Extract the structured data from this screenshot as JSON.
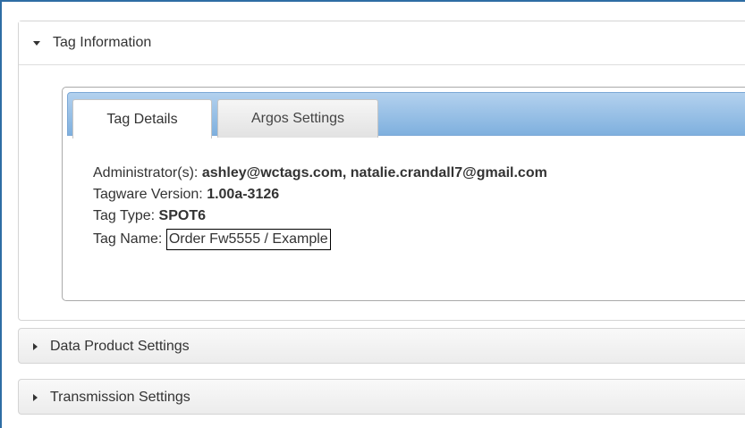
{
  "accordion": {
    "tag_information": {
      "title": "Tag Information",
      "tabs": [
        {
          "label": "Tag Details",
          "active": true
        },
        {
          "label": "Argos Settings",
          "active": false
        }
      ],
      "details": {
        "administrators_label": "Administrator(s):",
        "administrators_value": "ashley@wctags.com, natalie.crandall7@gmail.com",
        "tagware_label": "Tagware Version:",
        "tagware_value": "1.00a-3126",
        "tag_type_label": "Tag Type:",
        "tag_type_value": "SPOT6",
        "tag_name_label": "Tag Name:",
        "tag_name_value": "Order Fw5555 / Example"
      }
    },
    "data_product_settings": {
      "title": "Data Product Settings"
    },
    "transmission_settings": {
      "title": "Transmission Settings"
    }
  },
  "icons": {
    "expanded": "caret-down-icon",
    "collapsed": "caret-right-icon"
  },
  "colors": {
    "tab_bar_top": "#b3d1ee",
    "tab_bar_bottom": "#7fb0de",
    "frame_border": "#2e6da4"
  }
}
